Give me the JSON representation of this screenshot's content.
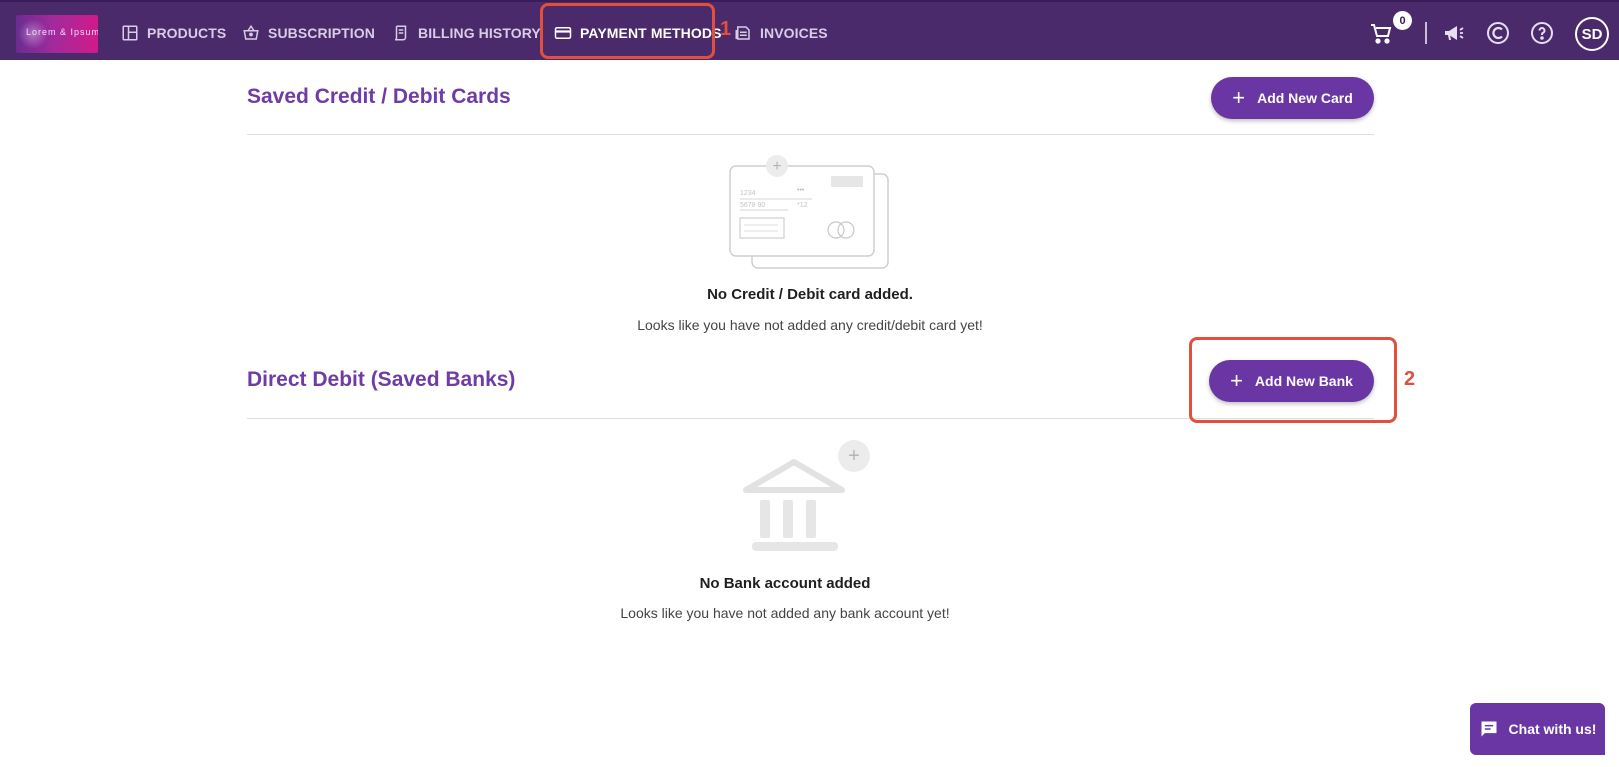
{
  "nav": {
    "logo_text": "Lorem & Ipsum",
    "items": [
      {
        "label": "PRODUCTS",
        "icon": "dashboard-icon"
      },
      {
        "label": "SUBSCRIPTION",
        "icon": "basket-icon"
      },
      {
        "label": "BILLING HISTORY",
        "icon": "receipt-icon"
      },
      {
        "label": "PAYMENT METHODS",
        "icon": "credit-card-icon",
        "active": true
      },
      {
        "label": "INVOICES",
        "icon": "document-icon"
      }
    ],
    "cart_count": "0",
    "avatar_initials": "SD",
    "right_icons": [
      "cart-icon",
      "megaphone-icon",
      "currency-icon",
      "help-icon"
    ]
  },
  "annotations": {
    "marker_1": "1",
    "marker_2": "2"
  },
  "cards_section": {
    "title": "Saved Credit / Debit Cards",
    "add_button": "Add New Card",
    "empty_title": "No Credit / Debit card added.",
    "empty_subtitle": "Looks like you have not added any credit/debit card yet!",
    "illustration_text": {
      "num1": "1234",
      "num2": "5678 90",
      "dots": "•••",
      "exp": "*12"
    }
  },
  "banks_section": {
    "title": "Direct Debit (Saved Banks)",
    "add_button": "Add New Bank",
    "empty_title": "No Bank account added",
    "empty_subtitle": "Looks like you have not added any bank account yet!"
  },
  "chat": {
    "label": "Chat with us!"
  },
  "colors": {
    "nav_bg": "#4a2a6b",
    "accent": "#6a36a3",
    "section_title": "#6f3ca6",
    "annotation": "#e0503c"
  }
}
